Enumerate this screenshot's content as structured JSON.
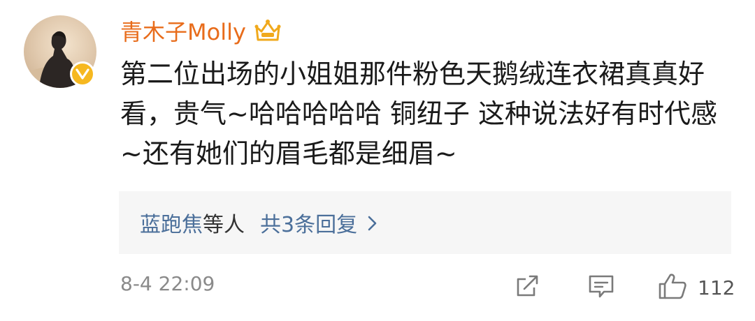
{
  "user": {
    "name": "青木子Molly",
    "avatar_icon": "avatar-photo",
    "verified_icon": "verified-v-badge",
    "membership_icon": "crown-icon",
    "name_color": "#e86c1b",
    "badge_color": "#f6b820"
  },
  "comment": {
    "text": "第二位出场的小姐姐那件粉色天鹅绒连衣裙真真好看，贵气~哈哈哈哈哈 铜纽子 这种说法好有时代感~还有她们的眉毛都是细眉~"
  },
  "replies": {
    "names": "蓝跑焦",
    "others": "等人",
    "count_label": "共3条回复",
    "link_color": "#4b6f9a"
  },
  "footer": {
    "timestamp": "8-4 22:09",
    "like_count": "112"
  }
}
